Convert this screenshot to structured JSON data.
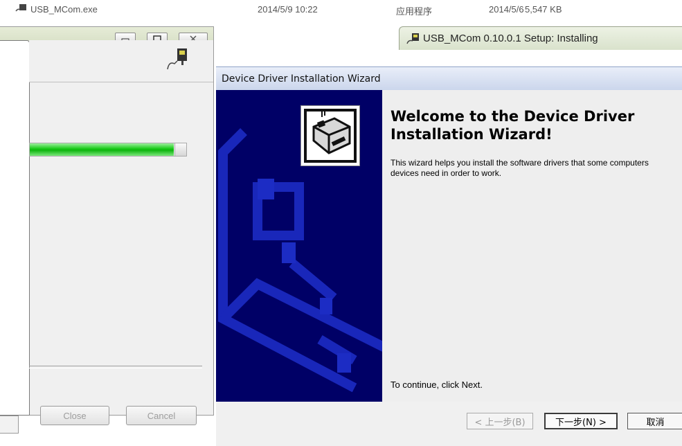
{
  "background_window": {
    "file_name": "USB_MCom.exe",
    "date_modified": "2014/5/9 10:22",
    "file_type": "应用程序",
    "date_2": "2014/5/6",
    "size": "5,547 KB"
  },
  "progress_window": {
    "progress_fraction": 0.92,
    "close_label": "Close",
    "cancel_label": "Cancel"
  },
  "setup_window": {
    "title": "USB_MCom 0.10.0.1 Setup: Installing"
  },
  "wizard": {
    "title": "Device Driver Installation Wizard",
    "heading": "Welcome to the Device Driver Installation Wizard!",
    "body": "This wizard helps you install the software drivers that some computers devices need in order to work.",
    "continue_text": "To continue, click Next.",
    "back_label": "< 上一步(B)",
    "next_label": "下一步(N) >",
    "cancel_label": "取消"
  },
  "colors": {
    "banner": "#000066",
    "progress": "#14c814",
    "caption": "#d2dbc0"
  }
}
